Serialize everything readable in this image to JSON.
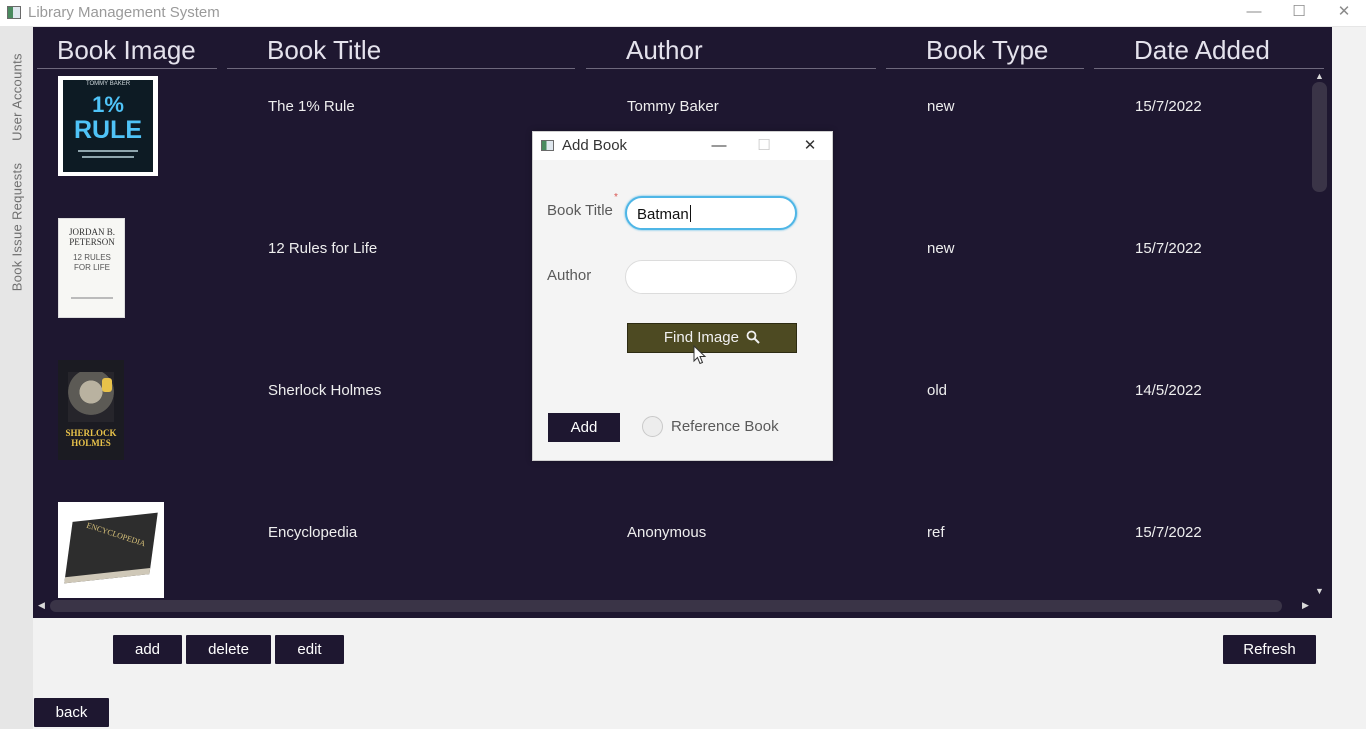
{
  "window": {
    "title": "Library Management System",
    "controls": {
      "minimize": "—",
      "maximize": "☐",
      "close": "✕"
    }
  },
  "sidebar": {
    "tabs": [
      {
        "label": "User Accounts"
      },
      {
        "label": "Book Issue Requests"
      }
    ]
  },
  "table": {
    "columns": [
      "Book Image",
      "Book Title",
      "Author",
      "Book Type",
      "Date Added"
    ],
    "rows": [
      {
        "cover": {
          "top_text": "TOMMY BAKER",
          "big_text": "1%",
          "sub_text": "RULE"
        },
        "title": "The 1% Rule",
        "author": "Tommy Baker",
        "type": "new",
        "date": "15/7/2022"
      },
      {
        "cover": {
          "top_text": "JORDAN B. PETERSON",
          "big_text": "12 RULES FOR LIFE"
        },
        "title": "12 Rules for Life",
        "author": "",
        "type": "new",
        "date": "15/7/2022"
      },
      {
        "cover": {
          "big_text": "SHERLOCK HOLMES"
        },
        "title": "Sherlock Holmes",
        "author": "",
        "type": "old",
        "date": "14/5/2022"
      },
      {
        "cover": {
          "big_text": "ENCYCLOPEDIA"
        },
        "title": "Encyclopedia",
        "author": "Anonymous",
        "type": "ref",
        "date": "15/7/2022"
      }
    ]
  },
  "actions": {
    "add": "add",
    "delete": "delete",
    "edit": "edit",
    "refresh": "Refresh",
    "back": "back"
  },
  "dialog": {
    "title": "Add Book",
    "controls": {
      "minimize": "—",
      "maximize": "☐",
      "close": "✕"
    },
    "book_title_label": "Book Title",
    "required_mark": "*",
    "book_title_value": "Batman",
    "author_label": "Author",
    "author_value": "",
    "find_image_label": "Find Image",
    "add_label": "Add",
    "reference_label": "Reference Book"
  },
  "colors": {
    "table_bg": "#1e1730",
    "find_button": "#4d4a22",
    "focus_ring": "#4fb6e6"
  }
}
